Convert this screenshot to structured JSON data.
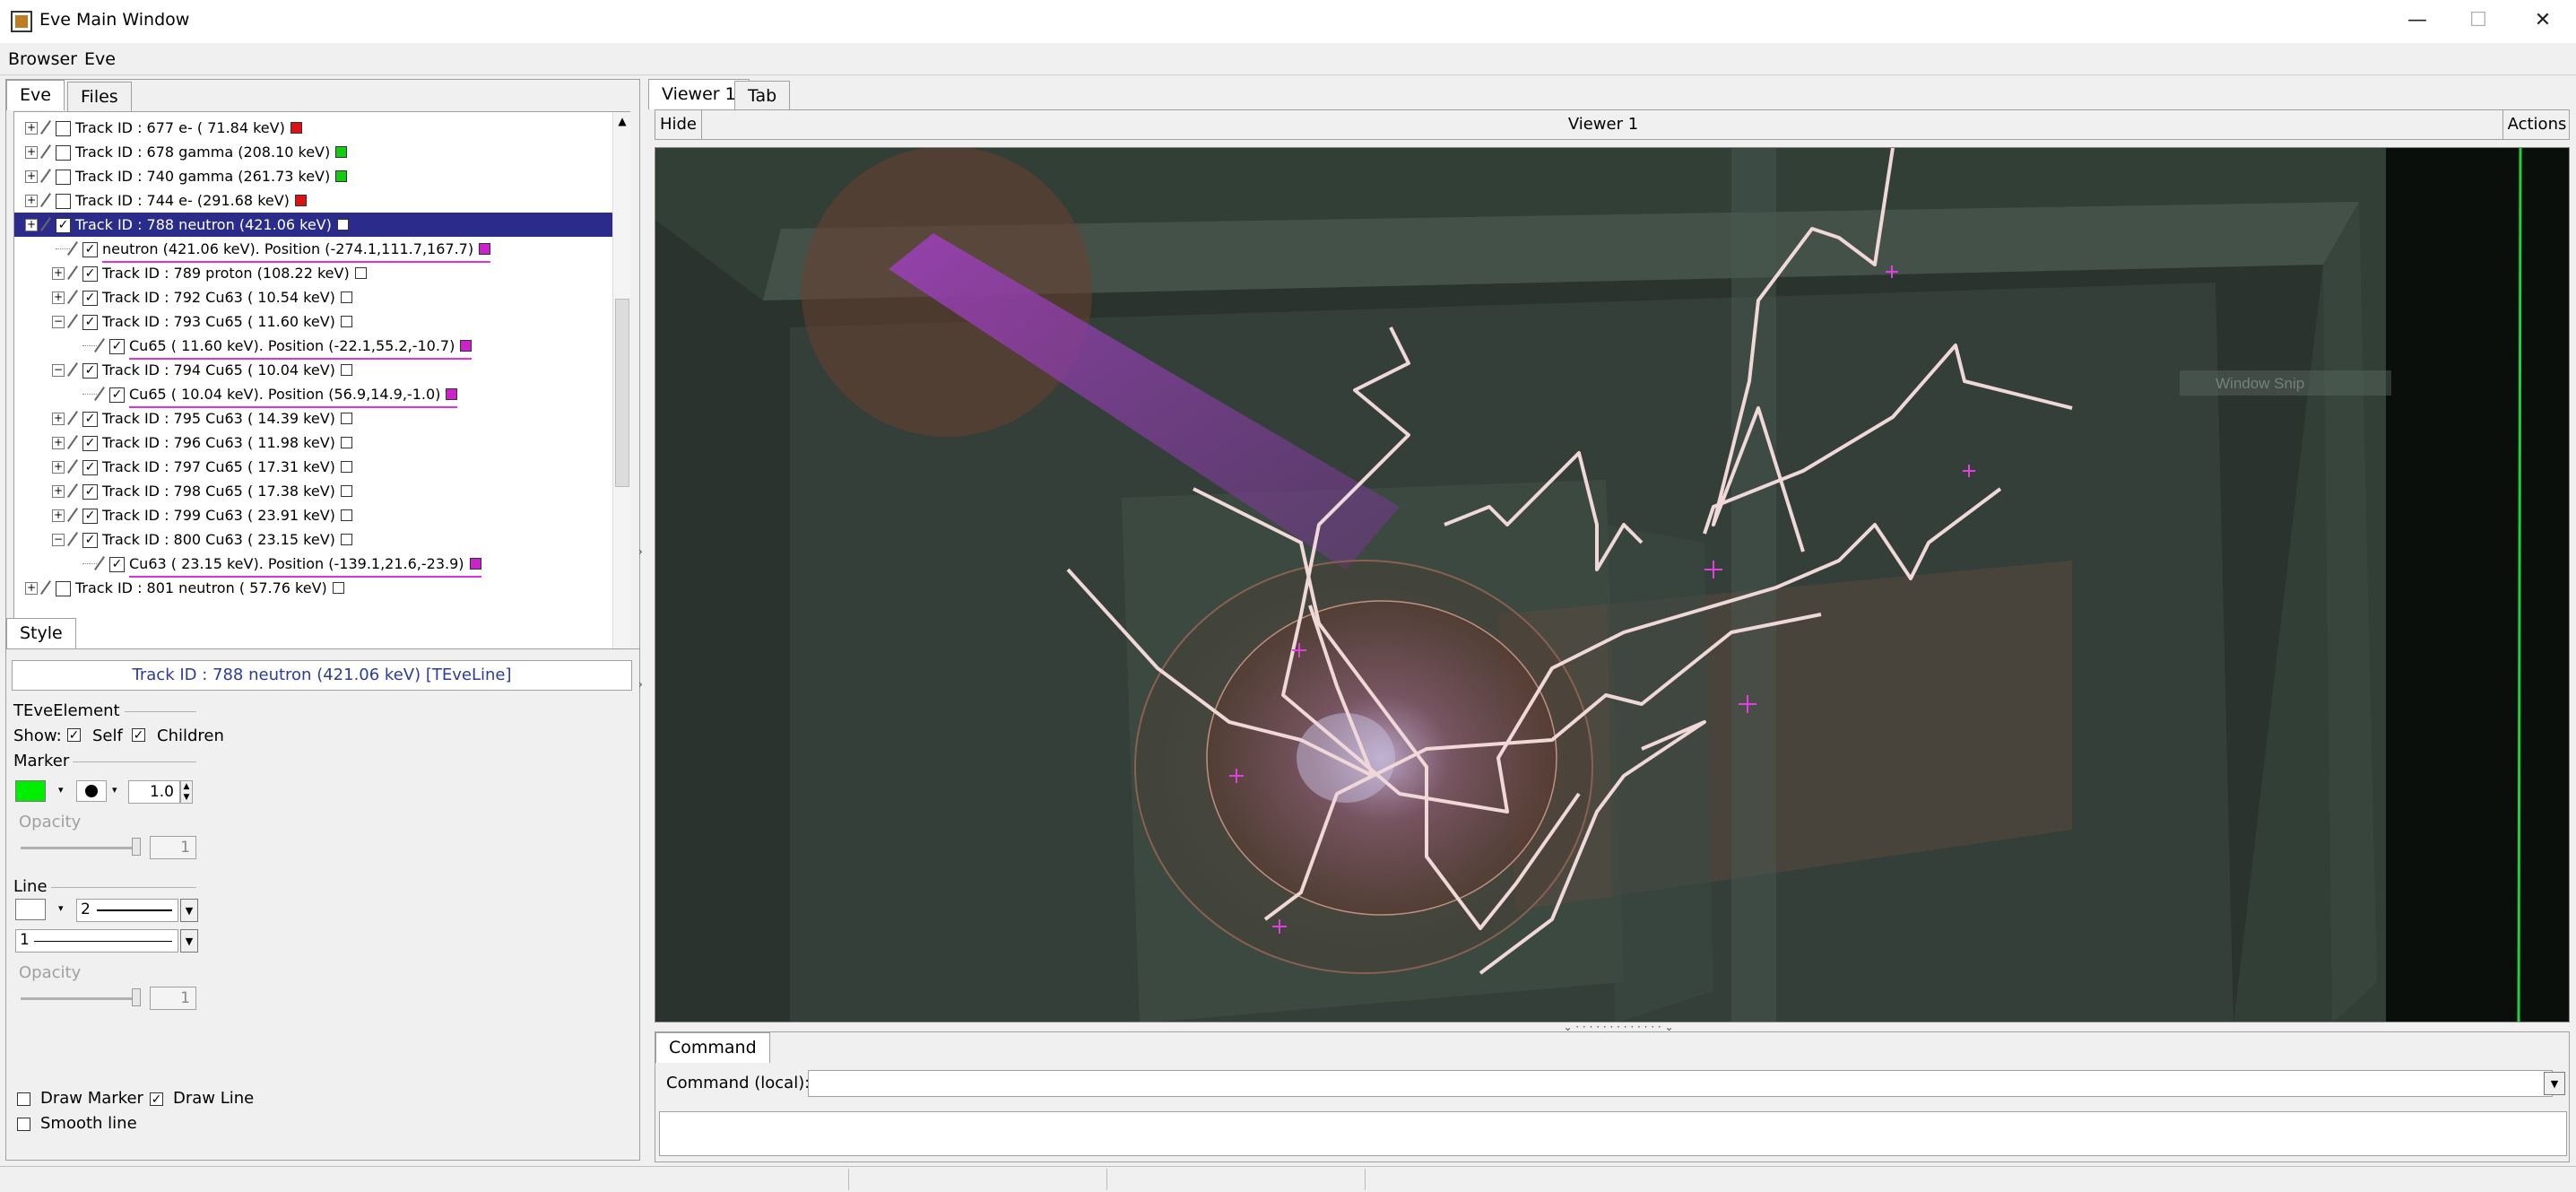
{
  "window": {
    "title": "Eve Main Window",
    "min": "—",
    "max": "☐",
    "close": "✕"
  },
  "menu": {
    "browser": "Browser",
    "eve": "Eve"
  },
  "left_tabs": [
    "Eve",
    "Files"
  ],
  "tree": {
    "rows": [
      {
        "label": "Track ID : 677 e- ( 71.84 keV)",
        "color": "#dd1111"
      },
      {
        "label": "Track ID : 678 gamma (208.10 keV)",
        "color": "#11cc11"
      },
      {
        "label": "Track ID : 740 gamma (261.73 keV)",
        "color": "#11cc11"
      },
      {
        "label": "Track ID : 744 e- (291.68 keV)",
        "color": "#dd1111"
      },
      {
        "label": "Track ID : 788 neutron (421.06 keV)",
        "color": "#ffffff"
      },
      {
        "label": "neutron (421.06 keV). Position (-274.1,111.7,167.7)",
        "color": "#cc22cc"
      },
      {
        "label": "Track ID : 789 proton (108.22 keV)",
        "color": "#ffffff"
      },
      {
        "label": "Track ID : 792 Cu63 ( 10.54 keV)",
        "color": "#ffffff"
      },
      {
        "label": "Track ID : 793 Cu65 ( 11.60 keV)",
        "color": "#ffffff"
      },
      {
        "label": "Cu65 ( 11.60 keV). Position (-22.1,55.2,-10.7)",
        "color": "#cc22cc"
      },
      {
        "label": "Track ID : 794 Cu65 ( 10.04 keV)",
        "color": "#ffffff"
      },
      {
        "label": "Cu65 ( 10.04 keV). Position (56.9,14.9,-1.0)",
        "color": "#cc22cc"
      },
      {
        "label": "Track ID : 795 Cu63 ( 14.39 keV)",
        "color": "#ffffff"
      },
      {
        "label": "Track ID : 796 Cu63 ( 11.98 keV)",
        "color": "#ffffff"
      },
      {
        "label": "Track ID : 797 Cu65 ( 17.31 keV)",
        "color": "#ffffff"
      },
      {
        "label": "Track ID : 798 Cu65 ( 17.38 keV)",
        "color": "#ffffff"
      },
      {
        "label": "Track ID : 799 Cu63 ( 23.91 keV)",
        "color": "#ffffff"
      },
      {
        "label": "Track ID : 800 Cu63 ( 23.15 keV)",
        "color": "#ffffff"
      },
      {
        "label": "Cu63 ( 23.15 keV). Position (-139.1,21.6,-23.9)",
        "color": "#cc22cc"
      },
      {
        "label": "Track ID : 801 neutron ( 57.76 keV)",
        "color": "#ffffff"
      }
    ]
  },
  "style_tab": "Style",
  "editor": {
    "selected": "Track ID : 788 neutron (421.06 keV) [TEveLine]",
    "group_element": "TEveElement",
    "show_label": "Show:",
    "self_label": "Self",
    "children_label": "Children",
    "marker_group": "Marker",
    "marker_color": "#00ee00",
    "marker_size": "1.0",
    "opacity_label": "Opacity",
    "marker_opacity": "1",
    "line_group": "Line",
    "line_color": "#ffffff",
    "line_width": "2",
    "line_style": "1",
    "line_opacity_label": "Opacity",
    "line_opacity": "1",
    "draw_marker": "Draw Marker",
    "draw_line": "Draw Line",
    "smooth_line": "Smooth line"
  },
  "viewer": {
    "tabs": [
      "Viewer 1",
      "Tab"
    ],
    "hide": "Hide",
    "name": "Viewer 1",
    "actions": "Actions",
    "window_snip": "Window Snip"
  },
  "command": {
    "tab": "Command",
    "label": "Command (local):",
    "value": ""
  }
}
